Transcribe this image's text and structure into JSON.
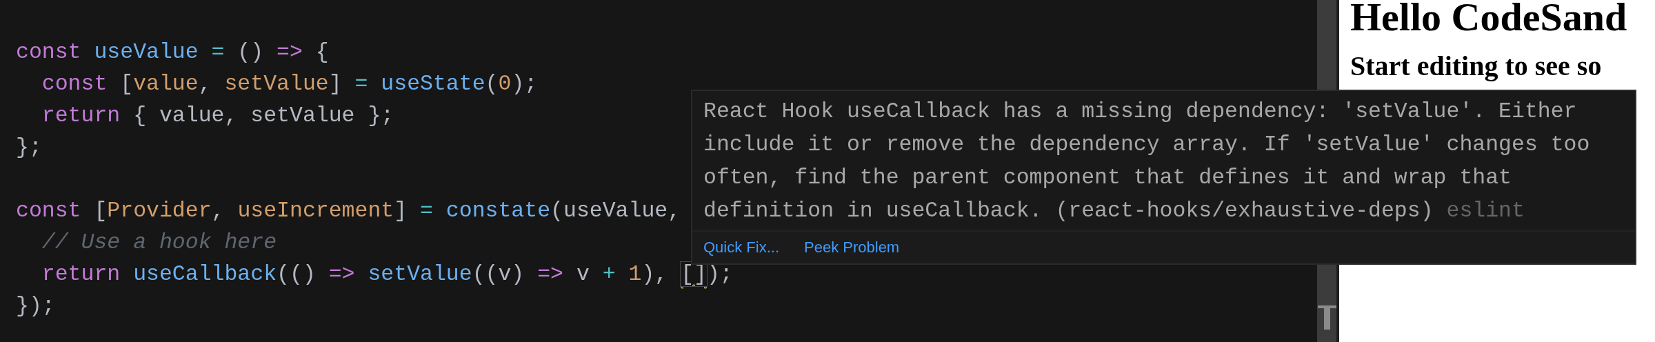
{
  "editor": {
    "lines": [
      {
        "gap_before": false,
        "tokens": [
          {
            "kind": "keyword",
            "text": "const"
          },
          {
            "kind": "function",
            "text": " useValue"
          },
          {
            "kind": "operator",
            "text": " ="
          },
          {
            "kind": "plain",
            "text": " ()"
          },
          {
            "kind": "keyword",
            "text": " =>"
          },
          {
            "kind": "plain",
            "text": " {"
          }
        ]
      },
      {
        "gap_before": false,
        "tokens": [
          {
            "kind": "keyword",
            "text": "  const"
          },
          {
            "kind": "plain",
            "text": " ["
          },
          {
            "kind": "variable",
            "text": "value"
          },
          {
            "kind": "plain",
            "text": ", "
          },
          {
            "kind": "variable",
            "text": "setValue"
          },
          {
            "kind": "plain",
            "text": "] "
          },
          {
            "kind": "operator",
            "text": "="
          },
          {
            "kind": "function",
            "text": " useState"
          },
          {
            "kind": "plain",
            "text": "("
          },
          {
            "kind": "number",
            "text": "0"
          },
          {
            "kind": "plain",
            "text": ");"
          }
        ]
      },
      {
        "gap_before": false,
        "tokens": [
          {
            "kind": "keyword",
            "text": "  return"
          },
          {
            "kind": "plain",
            "text": " { value, setValue };"
          }
        ]
      },
      {
        "gap_before": false,
        "tokens": [
          {
            "kind": "plain",
            "text": "};"
          }
        ]
      },
      {
        "gap_before": true,
        "tokens": [
          {
            "kind": "keyword",
            "text": "const"
          },
          {
            "kind": "plain",
            "text": " ["
          },
          {
            "kind": "variable",
            "text": "Provider"
          },
          {
            "kind": "plain",
            "text": ", "
          },
          {
            "kind": "variable",
            "text": "useIncrement"
          },
          {
            "kind": "plain",
            "text": "] "
          },
          {
            "kind": "operator",
            "text": "="
          },
          {
            "kind": "function",
            "text": " constate"
          },
          {
            "kind": "plain",
            "text": "(useValue,"
          }
        ]
      },
      {
        "gap_before": false,
        "tokens": [
          {
            "kind": "comment",
            "text": "  // Use a hook here"
          }
        ]
      },
      {
        "gap_before": false,
        "tokens": [
          {
            "kind": "keyword",
            "text": "  return"
          },
          {
            "kind": "function",
            "text": " useCallback"
          },
          {
            "kind": "plain",
            "text": "(()"
          },
          {
            "kind": "keyword",
            "text": " =>"
          },
          {
            "kind": "function",
            "text": " setValue"
          },
          {
            "kind": "plain",
            "text": "((v)"
          },
          {
            "kind": "keyword",
            "text": " =>"
          },
          {
            "kind": "plain",
            "text": " v"
          },
          {
            "kind": "operator",
            "text": " +"
          },
          {
            "kind": "number",
            "text": " 1"
          },
          {
            "kind": "plain",
            "text": "), "
          },
          {
            "kind": "warning",
            "text": "[]"
          },
          {
            "kind": "plain",
            "text": ");"
          }
        ]
      },
      {
        "gap_before": false,
        "tokens": [
          {
            "kind": "plain",
            "text": "});"
          }
        ]
      }
    ]
  },
  "hover": {
    "message": "React Hook useCallback has a missing dependency: 'setValue'. Either include it or remove the dependency array. If 'setValue' changes too often, find the parent component that defines it and wrap that definition in useCallback. (react-hooks/exhaustive-deps)",
    "source": "eslint",
    "actions": [
      "Quick Fix...",
      "Peek Problem"
    ]
  },
  "preview": {
    "heading": "Hello CodeSand",
    "subheading": "Start editing to see so"
  }
}
